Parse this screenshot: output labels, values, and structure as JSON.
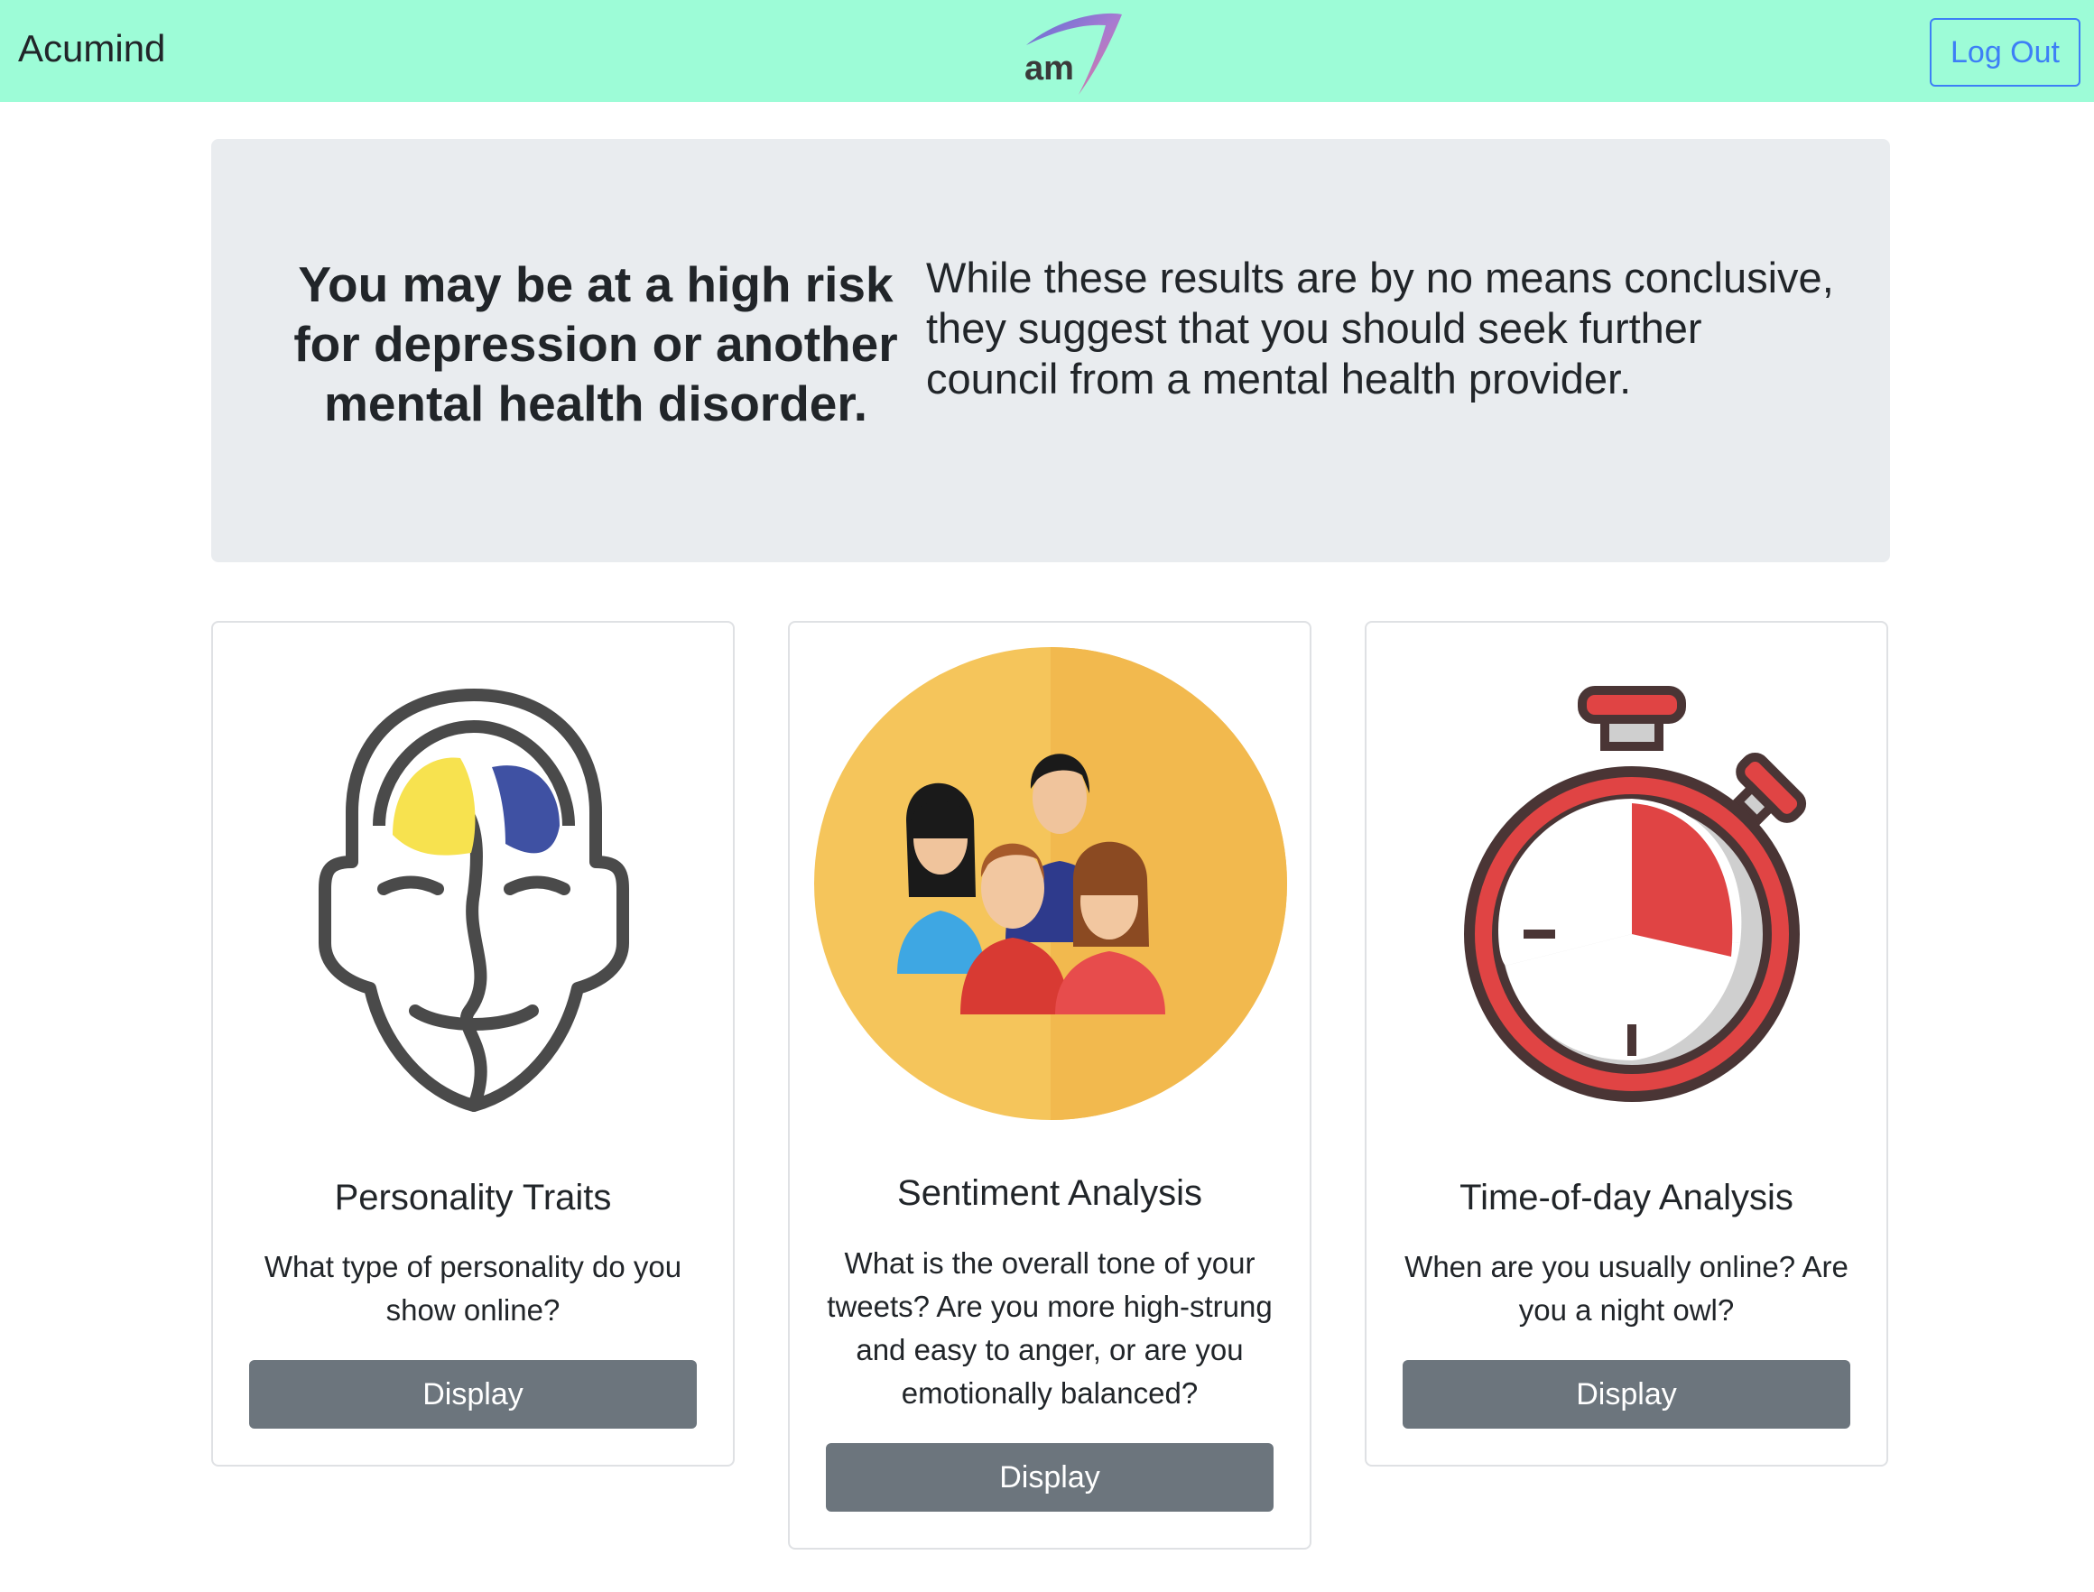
{
  "navbar": {
    "brand": "Acumind",
    "logo_text": "am",
    "logout_label": "Log Out"
  },
  "jumbotron": {
    "title": "You may be at a high risk for depression or another mental health disorder.",
    "text": "While these results are by no means conclusive, they suggest that you should seek further council from a mental health provider."
  },
  "cards": [
    {
      "icon": "brain-head-icon",
      "title": "Personality Traits",
      "text": "What type of personality do you show online?",
      "button_label": "Display"
    },
    {
      "icon": "group-people-icon",
      "title": "Sentiment Analysis",
      "text": "What is the overall tone of your tweets? Are you more high-strung and easy to anger, or are you emotionally balanced?",
      "button_label": "Display"
    },
    {
      "icon": "stopwatch-icon",
      "title": "Time-of-day Analysis",
      "text": "When are you usually online? Are you a night owl?",
      "button_label": "Display"
    }
  ],
  "colors": {
    "navbar_bg": "#9dfcd7",
    "link_blue": "#3d7ff6",
    "button_gray": "#6c757d",
    "jumbotron_bg": "#e9ecef"
  }
}
